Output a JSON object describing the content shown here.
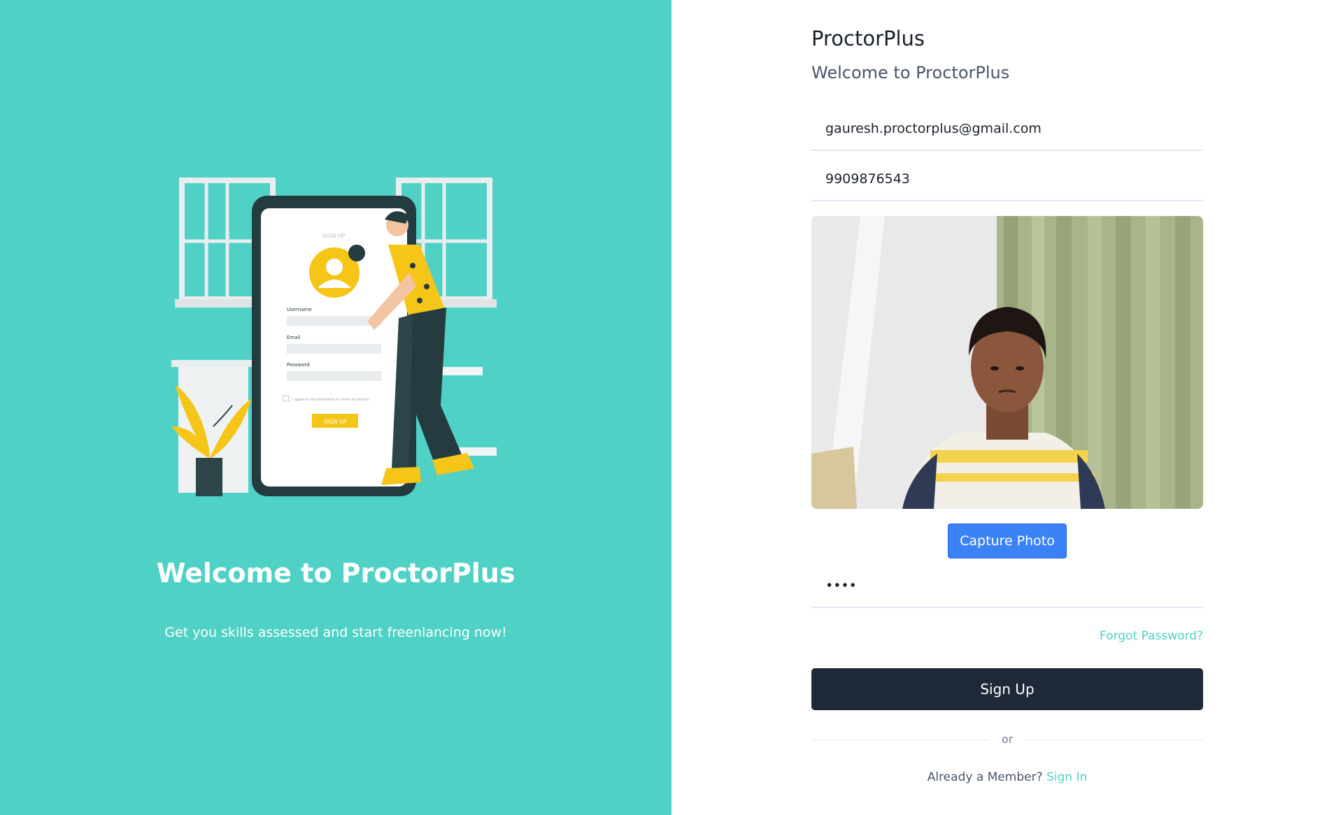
{
  "hero": {
    "title": "Welcome to ProctorPlus",
    "subtitle": "Get you skills assessed and start freenlancing now!"
  },
  "illustration": {
    "screen_title": "SIGN UP",
    "username_label": "Username",
    "email_label": "Email",
    "password_label": "Password",
    "agree_text": "I agree to all statements in terms of service",
    "button_label": "SIGN UP"
  },
  "form": {
    "brand": "ProctorPlus",
    "welcome": "Welcome to ProctorPlus",
    "email_value": "gauresh.proctorplus@gmail.com",
    "phone_value": "9909876543",
    "password_value": "abcd",
    "capture_label": "Capture Photo",
    "forgot_label": "Forgot Password?",
    "signup_label": "Sign Up",
    "divider_text": "or",
    "member_text": "Already a Member?",
    "signin_label": "Sign In"
  },
  "colors": {
    "accent": "#4fd1c5",
    "primary_button": "#3b82f6",
    "dark_button": "#1f2937"
  }
}
